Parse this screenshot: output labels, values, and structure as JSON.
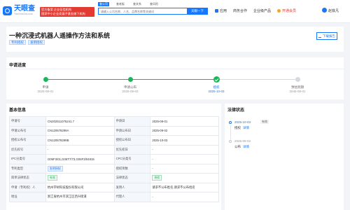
{
  "header": {
    "logo_title": "天眼查",
    "logo_sub": "TianYanCha.com",
    "promo_line1": "官方备案 企业征信机构",
    "promo_line2": "国家中小企业发展子基金旗下机构",
    "search_tabs": [
      "查公司",
      "查老板",
      "查关系",
      "查风险"
    ],
    "search_placeholder": "请输入公司名称、人名、品牌名称等关键词",
    "search_button": "天眼一下",
    "nav": {
      "app": "应用",
      "business": "商务合作",
      "enterprise": "企业级产品",
      "vip": "开通会员"
    },
    "username": "赵铁凡"
  },
  "title_section": {
    "title": "一种沉浸式机器人遥操作方法和系统",
    "tags": [
      "专利授权",
      "发明授权"
    ],
    "download_label": "下载报告"
  },
  "progress": {
    "section_title": "申请进度",
    "steps": [
      {
        "label": "申请",
        "date": "2025-08-01",
        "state": "done"
      },
      {
        "label": "申请公布",
        "date": "2025-09-02",
        "state": "done"
      },
      {
        "label": "授权",
        "date": "2025-10-03",
        "state": "current"
      },
      {
        "label": "预估到期",
        "date": "2045-08-01",
        "state": "pending"
      }
    ]
  },
  "basic_info": {
    "section_title": "基本信息",
    "rows": [
      [
        {
          "k": "申请号",
          "v": "CN202511075241.7"
        },
        {
          "k": "申请日",
          "v": "2025-08-01"
        }
      ],
      [
        {
          "k": "申请公布号",
          "v": "CN120578299A"
        },
        {
          "k": "申请公布日",
          "v": "2025-09-02"
        }
      ],
      [
        {
          "k": "授权公布号",
          "v": "CN120578299B"
        },
        {
          "k": "授权公布日",
          "v": "2025-10-03"
        }
      ],
      [
        {
          "k": "优先权号",
          "v": "-"
        },
        {
          "k": "优先权日",
          "v": "-"
        }
      ],
      [
        {
          "k": "IPC分类号",
          "v": "G06F3/01,G06T7/73,G06F3/04815"
        },
        {
          "k": "CPC分类号",
          "v": "-"
        }
      ],
      [
        {
          "k": "专利类型",
          "v": "发明授权",
          "tag": "blue"
        },
        {
          "k": "授权项数",
          "v": "-"
        }
      ],
      [
        {
          "k": "简单法律状态",
          "v": "有效",
          "tag": "green"
        },
        {
          "k": "法律状态",
          "v": "授权",
          "tag": "green"
        }
      ],
      [
        {
          "k": "申请（专利权）人",
          "v": "杭州宇树科技股份有限公司",
          "link": true
        },
        {
          "k": "发明人",
          "v": "请求不公布姓名,请求不公布姓名"
        }
      ],
      [
        {
          "k": "地址",
          "v": "浙江省杭州市滨江区西兴街道"
        },
        {
          "k": "代理人",
          "v": "-"
        }
      ]
    ]
  },
  "legal_status": {
    "section_title": "法律状态",
    "items": [
      {
        "date": "2025-10-03",
        "badge": "有效",
        "desc": "授权",
        "link": "详情"
      },
      {
        "date": "2025-09-02",
        "desc": "公布",
        "link": "详情"
      }
    ]
  }
}
